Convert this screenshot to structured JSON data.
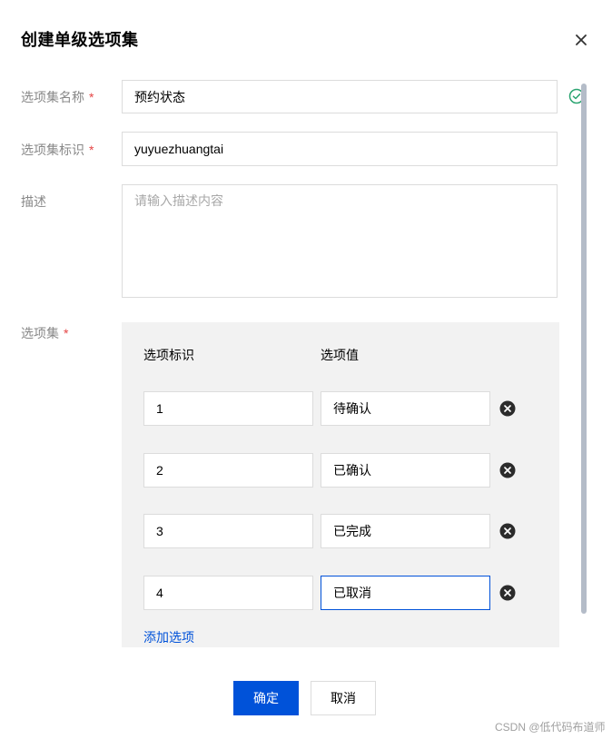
{
  "dialog": {
    "title": "创建单级选项集"
  },
  "form": {
    "name_label": "选项集名称",
    "name_value": "预约状态",
    "key_label": "选项集标识",
    "key_value": "yuyuezhuangtai",
    "desc_label": "描述",
    "desc_placeholder": "请输入描述内容",
    "options_label": "选项集",
    "required_mark": "*"
  },
  "options": {
    "col_key": "选项标识",
    "col_value": "选项值",
    "rows": [
      {
        "key": "1",
        "value": "待确认"
      },
      {
        "key": "2",
        "value": "已确认"
      },
      {
        "key": "3",
        "value": "已完成"
      },
      {
        "key": "4",
        "value": "已取消"
      }
    ],
    "add_label": "添加选项"
  },
  "footer": {
    "confirm_label": "确定",
    "cancel_label": "取消"
  },
  "watermark": "CSDN @低代码布道师",
  "colors": {
    "primary": "#0052d9",
    "required": "#e54545",
    "valid": "#2ba471",
    "panel_bg": "#f2f2f2"
  },
  "icons": {
    "close": "close-icon",
    "valid": "check-circle-icon",
    "delete": "close-circle-filled-icon"
  }
}
